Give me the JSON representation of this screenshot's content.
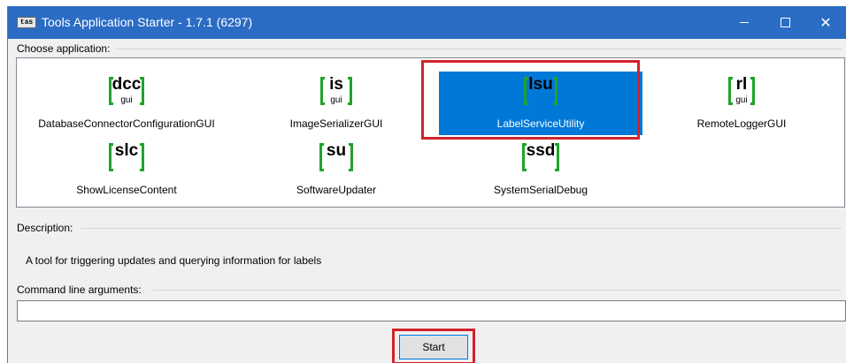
{
  "window": {
    "logo_text": "tas",
    "title": "Tools Application Starter - 1.7.1 (6297)",
    "buttons": [
      "minimize-icon",
      "maximize-icon",
      "close-icon"
    ],
    "close_glyph": "✕"
  },
  "choose": {
    "label": "Choose application:",
    "apps": [
      {
        "code": "dcc",
        "sub": "gui",
        "name": "DatabaseConnectorConfigurationGUI",
        "selected": false
      },
      {
        "code": "is",
        "sub": "gui",
        "name": "ImageSerializerGUI",
        "selected": false
      },
      {
        "code": "lsu",
        "sub": "",
        "name": "LabelServiceUtility",
        "selected": true
      },
      {
        "code": "rl",
        "sub": "gui",
        "name": "RemoteLoggerGUI",
        "selected": false
      },
      {
        "code": "slc",
        "sub": "",
        "name": "ShowLicenseContent",
        "selected": false
      },
      {
        "code": "su",
        "sub": "",
        "name": "SoftwareUpdater",
        "selected": false
      },
      {
        "code": "ssd",
        "sub": "",
        "name": "SystemSerialDebug",
        "selected": false
      }
    ]
  },
  "description": {
    "label": "Description:",
    "text": "A tool for triggering updates and querying information for labels"
  },
  "command": {
    "label": "Command line arguments:",
    "value": ""
  },
  "start_label": "Start",
  "colors": {
    "titlebar": "#2b6cc4",
    "selection": "#0078d7",
    "bracket": "#1fa32a",
    "highlight": "#d1232a"
  }
}
